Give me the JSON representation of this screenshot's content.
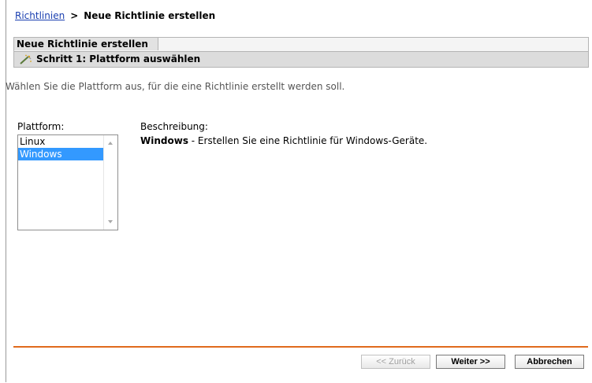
{
  "breadcrumb": {
    "root": "Richtlinien",
    "separator": ">",
    "current": "Neue Richtlinie erstellen"
  },
  "wizard": {
    "title": "Neue Richtlinie erstellen",
    "step": "Schritt 1: Plattform auswählen",
    "step_icon": "wand-icon"
  },
  "instruction": "Wählen Sie die Plattform aus, für die eine Richtlinie erstellt werden soll.",
  "platform": {
    "label": "Plattform:",
    "options": [
      "Linux",
      "Windows"
    ],
    "selected": "Windows"
  },
  "description": {
    "label": "Beschreibung:",
    "name": "Windows",
    "text": " - Erstellen Sie eine Richtlinie für Windows-Geräte."
  },
  "buttons": {
    "back": "<< Zurück",
    "next": "Weiter >>",
    "cancel": "Abbrechen"
  },
  "colors": {
    "accent_rule": "#e06a1c",
    "selection": "#3399ff",
    "link": "#1a3fb0"
  }
}
